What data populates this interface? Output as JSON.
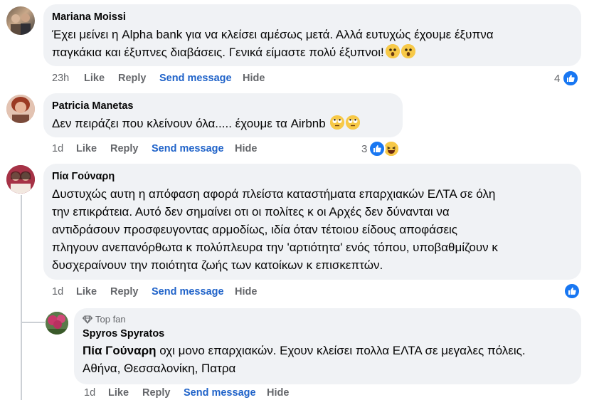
{
  "comments": [
    {
      "author": "Mariana Moissi",
      "text": "Έχει μείνει η Alpha bank για να κλείσει αμέσως μετά. Αλλά ευτυχώς έχουμε έξυπνα παγκάκια και έξυπνες διαβάσεις. Γενικά είμαστε πολύ έξυπνοι!",
      "text_line1": "Έχει μείνει η Alpha bank για να κλείσει αμέσως μετά. Αλλά ευτυχώς έχουμε έξυπνα",
      "text_line2": "παγκάκια και έξυπνες διαβάσεις. Γενικά είμαστε πολύ έξυπνοι!",
      "time": "23h",
      "like": "Like",
      "reply": "Reply",
      "send": "Send message",
      "hide": "Hide",
      "reaction_count": "4"
    },
    {
      "author": "Patricia Manetas",
      "text": "Δεν πειράζει που κλείνουν όλα..... έχουμε τα Airbnb",
      "time": "1d",
      "like": "Like",
      "reply": "Reply",
      "send": "Send message",
      "hide": "Hide",
      "reaction_count": "3"
    },
    {
      "author": "Πία Γούναρη",
      "lines": [
        "Δυστυχώς αυτη η απόφαση αφορά πλείστα καταστήματα επαρχιακών ΕΛΤΑ σε όλη",
        "την επικράτεια. Αυτό δεν σημαίνει οτι οι πολίτες κ οι Αρχές δεν δύνανται να",
        "αντιδράσουν προσφευγοντας αρμοδίως, ιδία όταν τέτοιου είδους αποφάσεις",
        "πληγουν ανεπανόρθωτα κ πολύπλευρα την 'αρτιότητα' ενός τόπου, υποβαθμίζουν κ",
        "δυσχεραίνουν την ποιότητα ζωής των κατοίκων κ επισκεπτών."
      ],
      "time": "1d",
      "like": "Like",
      "reply": "Reply",
      "send": "Send message",
      "hide": "Hide"
    }
  ],
  "reply": {
    "badge": "Top fan",
    "author": "Spyros Spyratos",
    "mention": "Πία Γούναρη",
    "line1": " οχι μονο επαρχιακών. Εχουν κλείσει πολλα ΕΛΤΑ σε μεγαλες πόλεις.",
    "line2": "Αθήνα, Θεσσαλονίκη, Πατρα",
    "time": "1d",
    "like": "Like",
    "reply": "Reply",
    "send": "Send message",
    "hide": "Hide"
  },
  "colors": {
    "bubble": "#f0f2f5",
    "link": "#2063c9",
    "like_blue": "#1877f2",
    "muted": "#65676b"
  },
  "icons": {
    "like": "thumbs-up-icon",
    "haha": "laughing-emoji-icon",
    "shocked": "astonished-emoji-icon",
    "eyeroll": "eye-roll-emoji-icon",
    "diamond": "diamond-icon"
  }
}
